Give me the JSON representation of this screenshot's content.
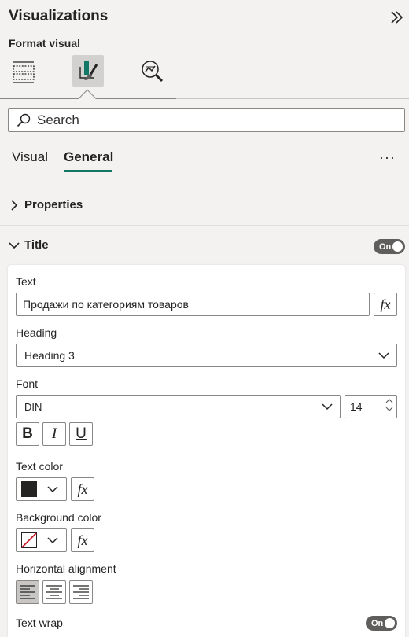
{
  "pane": {
    "title": "Visualizations"
  },
  "format": {
    "section_label": "Format visual"
  },
  "search": {
    "placeholder": "Search"
  },
  "tabs": [
    {
      "label": "Visual",
      "active": false
    },
    {
      "label": "General",
      "active": true
    }
  ],
  "more_label": "···",
  "sections": {
    "properties": {
      "label": "Properties",
      "expanded": false
    },
    "title": {
      "label": "Title",
      "expanded": true,
      "toggle": "On"
    }
  },
  "title_card": {
    "text": {
      "label": "Text",
      "value": "Продажи по категориям товаров",
      "fx": "fx"
    },
    "heading": {
      "label": "Heading",
      "value": "Heading 3"
    },
    "font": {
      "label": "Font",
      "family": "DIN",
      "size": "14",
      "bold": "B",
      "italic": "I",
      "underline": "U"
    },
    "text_color": {
      "label": "Text color",
      "value": "#252423",
      "fx": "fx"
    },
    "bg_color": {
      "label": "Background color",
      "value": "none",
      "fx": "fx"
    },
    "alignment": {
      "label": "Horizontal alignment",
      "selected": "left"
    },
    "text_wrap": {
      "label": "Text wrap",
      "toggle": "On"
    }
  },
  "colors": {
    "accent": "#117865",
    "toggle_bg": "#605e5c",
    "border": "#8a8886"
  }
}
